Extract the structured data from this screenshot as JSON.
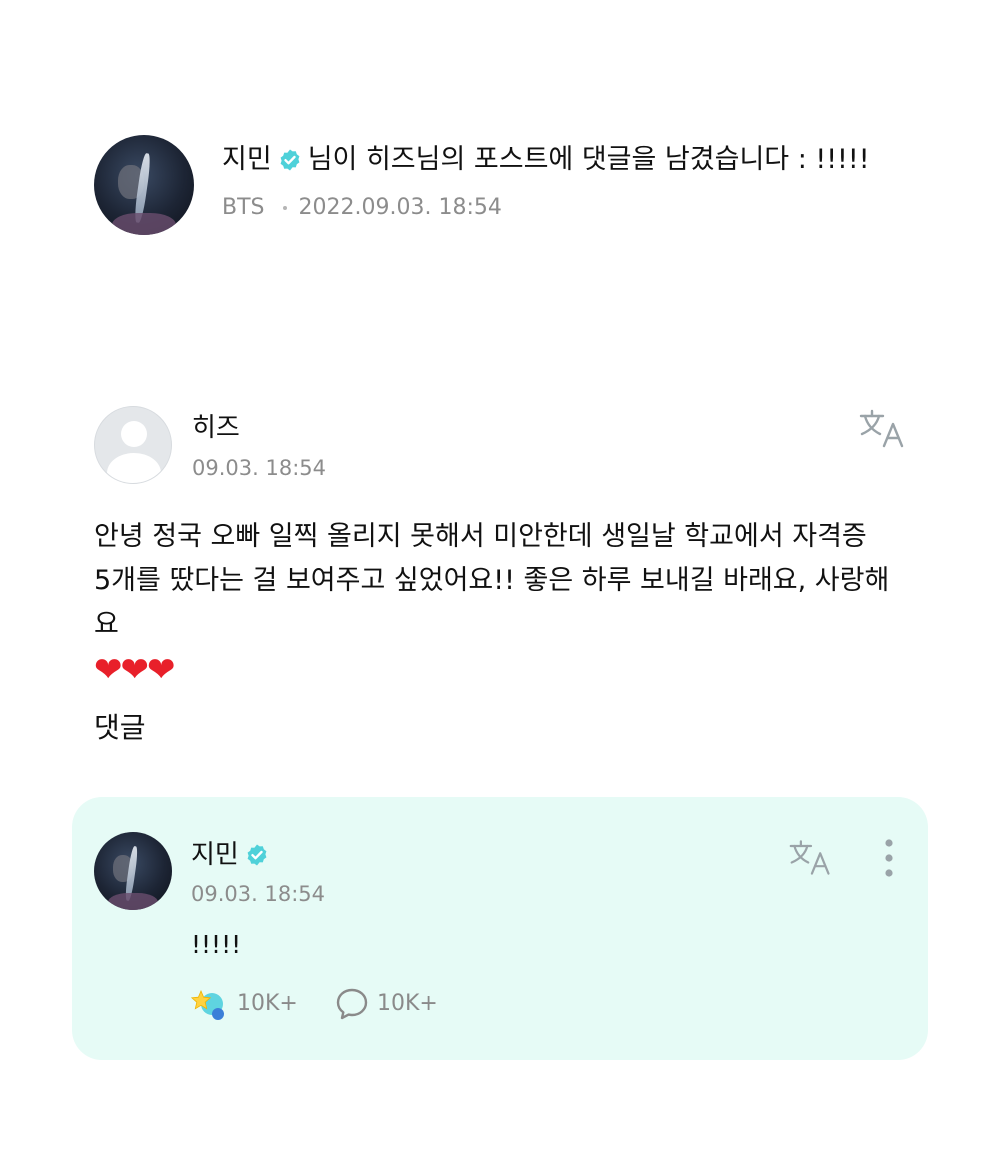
{
  "notification": {
    "author": "지민",
    "message": "님이 히즈님의 포스트에 댓글을 남겼습니다 : !!!!!",
    "community": "BTS",
    "datetime": "2022.09.03. 18:54",
    "avatar_icon": "profile-photo",
    "badge_icon": "verified-badge-icon"
  },
  "post": {
    "author": "히즈",
    "time": "09.03. 18:54",
    "body_line1": "안녕 정국 오빠 일찍 올리지 못해서 미안한데 생일날 학교에서 자격증",
    "body_line2": "5개를 땄다는 걸 보여주고 싶었어요!! 좋은 하루 보내길 바래요, 사랑해요",
    "hearts": "❤❤❤",
    "translate_icon": "translate-icon"
  },
  "comments_section": {
    "title": "댓글"
  },
  "comment": {
    "author": "지민",
    "time": "09.03. 18:54",
    "text": "!!!!!",
    "likes": "10K+",
    "replies": "10K+",
    "more_icon": "more-vertical-icon",
    "card_color": "#e6fbf6"
  },
  "colors": {
    "accent": "#4fd1d9",
    "muted_text": "#8c8c8c"
  }
}
